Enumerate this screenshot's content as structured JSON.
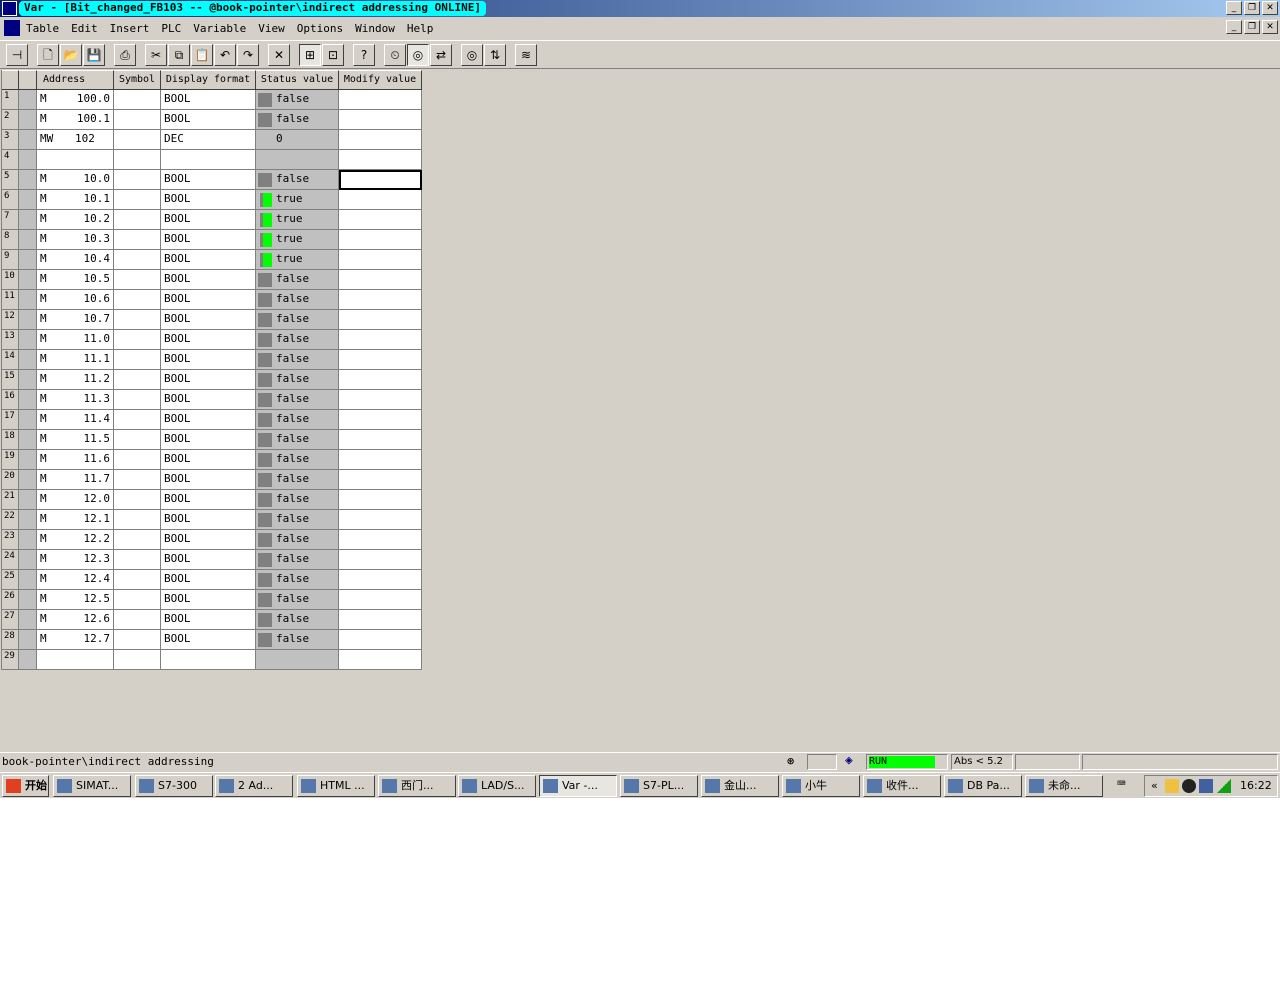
{
  "window": {
    "title": "Var - [Bit_changed_FB103 -- @book-pointer\\indirect addressing  ONLINE]",
    "controls": [
      "_",
      "❐",
      "✕"
    ]
  },
  "menu": [
    "Table",
    "Edit",
    "Insert",
    "PLC",
    "Variable",
    "View",
    "Options",
    "Window",
    "Help"
  ],
  "toolbar": [
    {
      "icon": "pin-icon",
      "glyph": "⊣"
    },
    {
      "sep": true
    },
    {
      "icon": "new-icon",
      "glyph": "🗋"
    },
    {
      "icon": "open-icon",
      "glyph": "📂"
    },
    {
      "icon": "save-icon",
      "glyph": "💾"
    },
    {
      "sep": true
    },
    {
      "icon": "print-icon",
      "glyph": "⎙"
    },
    {
      "sep": true
    },
    {
      "icon": "cut-icon",
      "glyph": "✂"
    },
    {
      "icon": "copy-icon",
      "glyph": "⧉"
    },
    {
      "icon": "paste-icon",
      "glyph": "📋"
    },
    {
      "icon": "undo-icon",
      "glyph": "↶"
    },
    {
      "icon": "redo-icon",
      "glyph": "↷"
    },
    {
      "sep": true
    },
    {
      "icon": "delete-icon",
      "glyph": "✕"
    },
    {
      "sep": true
    },
    {
      "icon": "network-icon",
      "glyph": "⊞",
      "pressed": true
    },
    {
      "icon": "station-icon",
      "glyph": "⊡"
    },
    {
      "sep": true
    },
    {
      "icon": "help-icon",
      "glyph": "?"
    },
    {
      "sep": true
    },
    {
      "icon": "trigger-icon",
      "glyph": "⏲"
    },
    {
      "icon": "monitor-icon",
      "glyph": "◎",
      "pressed": true
    },
    {
      "icon": "modify-icon",
      "glyph": "⇄"
    },
    {
      "sep": true
    },
    {
      "icon": "monitor-once-icon",
      "glyph": "◎"
    },
    {
      "icon": "modify-once-icon",
      "glyph": "⇅"
    },
    {
      "sep": true
    },
    {
      "icon": "force-icon",
      "glyph": "≋"
    }
  ],
  "table": {
    "headers": [
      "Address",
      "Symbol",
      "Display format",
      "Status value",
      "Modify value"
    ],
    "rows": [
      {
        "n": "1",
        "op": "M",
        "addr": "100.0",
        "fmt": "BOOL",
        "status": "false",
        "ind": "off"
      },
      {
        "n": "2",
        "op": "M",
        "addr": "100.1",
        "fmt": "BOOL",
        "status": "false",
        "ind": "off"
      },
      {
        "n": "3",
        "op": "MW",
        "addr": "102",
        "fmt": "DEC",
        "status": "0",
        "ind": "none"
      },
      {
        "n": "4",
        "op": "",
        "addr": "",
        "fmt": "",
        "status": "",
        "ind": "none"
      },
      {
        "n": "5",
        "op": "M",
        "addr": "10.0",
        "fmt": "BOOL",
        "status": "false",
        "ind": "off",
        "focus": true
      },
      {
        "n": "6",
        "op": "M",
        "addr": "10.1",
        "fmt": "BOOL",
        "status": "true",
        "ind": "on"
      },
      {
        "n": "7",
        "op": "M",
        "addr": "10.2",
        "fmt": "BOOL",
        "status": "true",
        "ind": "on"
      },
      {
        "n": "8",
        "op": "M",
        "addr": "10.3",
        "fmt": "BOOL",
        "status": "true",
        "ind": "on"
      },
      {
        "n": "9",
        "op": "M",
        "addr": "10.4",
        "fmt": "BOOL",
        "status": "true",
        "ind": "on"
      },
      {
        "n": "10",
        "op": "M",
        "addr": "10.5",
        "fmt": "BOOL",
        "status": "false",
        "ind": "off"
      },
      {
        "n": "11",
        "op": "M",
        "addr": "10.6",
        "fmt": "BOOL",
        "status": "false",
        "ind": "off"
      },
      {
        "n": "12",
        "op": "M",
        "addr": "10.7",
        "fmt": "BOOL",
        "status": "false",
        "ind": "off"
      },
      {
        "n": "13",
        "op": "M",
        "addr": "11.0",
        "fmt": "BOOL",
        "status": "false",
        "ind": "off"
      },
      {
        "n": "14",
        "op": "M",
        "addr": "11.1",
        "fmt": "BOOL",
        "status": "false",
        "ind": "off"
      },
      {
        "n": "15",
        "op": "M",
        "addr": "11.2",
        "fmt": "BOOL",
        "status": "false",
        "ind": "off"
      },
      {
        "n": "16",
        "op": "M",
        "addr": "11.3",
        "fmt": "BOOL",
        "status": "false",
        "ind": "off"
      },
      {
        "n": "17",
        "op": "M",
        "addr": "11.4",
        "fmt": "BOOL",
        "status": "false",
        "ind": "off"
      },
      {
        "n": "18",
        "op": "M",
        "addr": "11.5",
        "fmt": "BOOL",
        "status": "false",
        "ind": "off"
      },
      {
        "n": "19",
        "op": "M",
        "addr": "11.6",
        "fmt": "BOOL",
        "status": "false",
        "ind": "off"
      },
      {
        "n": "20",
        "op": "M",
        "addr": "11.7",
        "fmt": "BOOL",
        "status": "false",
        "ind": "off"
      },
      {
        "n": "21",
        "op": "M",
        "addr": "12.0",
        "fmt": "BOOL",
        "status": "false",
        "ind": "off"
      },
      {
        "n": "22",
        "op": "M",
        "addr": "12.1",
        "fmt": "BOOL",
        "status": "false",
        "ind": "off"
      },
      {
        "n": "23",
        "op": "M",
        "addr": "12.2",
        "fmt": "BOOL",
        "status": "false",
        "ind": "off"
      },
      {
        "n": "24",
        "op": "M",
        "addr": "12.3",
        "fmt": "BOOL",
        "status": "false",
        "ind": "off"
      },
      {
        "n": "25",
        "op": "M",
        "addr": "12.4",
        "fmt": "BOOL",
        "status": "false",
        "ind": "off"
      },
      {
        "n": "26",
        "op": "M",
        "addr": "12.5",
        "fmt": "BOOL",
        "status": "false",
        "ind": "off"
      },
      {
        "n": "27",
        "op": "M",
        "addr": "12.6",
        "fmt": "BOOL",
        "status": "false",
        "ind": "off"
      },
      {
        "n": "28",
        "op": "M",
        "addr": "12.7",
        "fmt": "BOOL",
        "status": "false",
        "ind": "off"
      },
      {
        "n": "29",
        "op": "",
        "addr": "",
        "fmt": "",
        "status": "",
        "ind": "none"
      }
    ]
  },
  "statusbar": {
    "path": "book-pointer\\indirect addressing",
    "mode": "RUN",
    "mode_color": "#00ff00",
    "abs": "Abs < 5.2"
  },
  "taskbar": {
    "start": "开始",
    "tasks": [
      "SIMAT...",
      "S7-300",
      "2 Ad...",
      "HTML ...",
      "西门...",
      "LAD/S...",
      "Var -...",
      "S7-PL...",
      "金山...",
      "小牛",
      "收件...",
      "DB Pa...",
      "未命..."
    ],
    "active": "Var -...",
    "clock": "16:22"
  }
}
